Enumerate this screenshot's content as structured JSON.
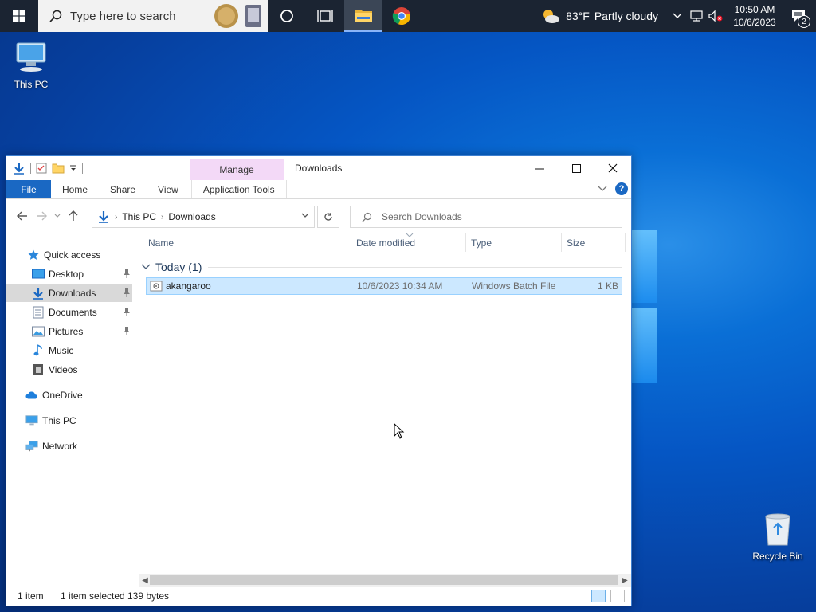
{
  "taskbar": {
    "search_placeholder": "Type here to search",
    "weather_temp": "83°F",
    "weather_desc": "Partly cloudy",
    "clock_time": "10:50 AM",
    "clock_date": "10/6/2023",
    "notification_count": "2"
  },
  "desktop": {
    "this_pc_label": "This PC",
    "recycle_bin_label": "Recycle Bin"
  },
  "window": {
    "title": "Downloads",
    "contextual_group": "Manage",
    "ribbon_tabs": {
      "file": "File",
      "home": "Home",
      "share": "Share",
      "view": "View",
      "application_tools": "Application Tools"
    },
    "address": {
      "crumbs": [
        "This PC",
        "Downloads"
      ]
    },
    "search_placeholder": "Search Downloads",
    "nav": {
      "quick_access": "Quick access",
      "desktop": "Desktop",
      "downloads": "Downloads",
      "documents": "Documents",
      "pictures": "Pictures",
      "music": "Music",
      "videos": "Videos",
      "onedrive": "OneDrive",
      "this_pc": "This PC",
      "network": "Network"
    },
    "columns": {
      "name": "Name",
      "date_modified": "Date modified",
      "type": "Type",
      "size": "Size"
    },
    "group_label": "Today (1)",
    "files": [
      {
        "name": "akangaroo",
        "date_modified": "10/6/2023 10:34 AM",
        "type": "Windows Batch File",
        "size": "1 KB"
      }
    ],
    "status": {
      "item_count": "1 item",
      "selected": "1 item selected",
      "size": "139 bytes"
    }
  },
  "colors": {
    "accent": "#1a68c3",
    "selection": "#cce8ff",
    "manage_tab": "#f3d9f7",
    "taskbar": "#1b2432"
  }
}
